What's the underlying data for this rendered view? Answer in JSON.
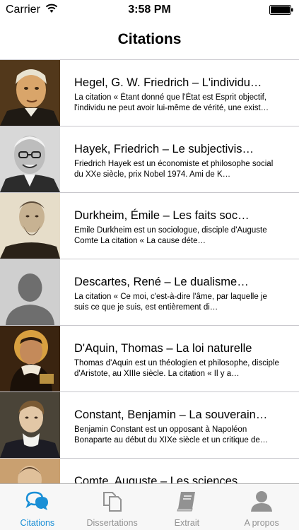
{
  "status_bar": {
    "carrier": "Carrier",
    "time": "3:58 PM"
  },
  "nav": {
    "title": "Citations"
  },
  "rows": [
    {
      "title": "Hegel, G. W. Friedrich – L'individu…",
      "subtitle": "La citation  « Étant donné que l'État est Esprit objectif, l'individu ne peut avoir lui-même de vérité, une exist…",
      "portrait": "hegel-portrait"
    },
    {
      "title": "Hayek, Friedrich – Le subjectivis…",
      "subtitle": "Friedrich Hayek est un économiste et philosophe social du XXe siècle, prix Nobel 1974. Ami de K…",
      "portrait": "hayek-portrait"
    },
    {
      "title": "Durkheim, Émile – Les faits soc…",
      "subtitle": "Emile Durkheim est un sociologue, disciple d'Auguste Comte  La citation  « La cause déte…",
      "portrait": "durkheim-portrait"
    },
    {
      "title": "Descartes, René – Le dualisme…",
      "subtitle": "La citation  « Ce moi, c'est-à-dire l'âme, par laquelle je suis ce que je suis, est entièrement di…",
      "portrait": "placeholder-avatar"
    },
    {
      "title": "D'Aquin, Thomas – La loi naturelle",
      "subtitle": "Thomas d'Aquin est un théologien et philosophe, disciple d'Aristote, au XIIIe siècle.  La citation  « Il y a…",
      "portrait": "aquinas-portrait"
    },
    {
      "title": "Constant, Benjamin – La souverain…",
      "subtitle": "Benjamin Constant est un opposant à Napoléon Bonaparte au début du XIXe siècle et un critique de…",
      "portrait": "constant-portrait"
    },
    {
      "title": "Comte, Auguste – Les sciences",
      "subtitle": "",
      "portrait": "comte-portrait"
    }
  ],
  "tabs": [
    {
      "label": "Citations",
      "icon": "speech-bubbles-icon",
      "active": true
    },
    {
      "label": "Dissertations",
      "icon": "documents-icon",
      "active": false
    },
    {
      "label": "Extrait",
      "icon": "book-icon",
      "active": false
    },
    {
      "label": "A propos",
      "icon": "person-icon",
      "active": false
    }
  ],
  "colors": {
    "accent": "#1a8fd6",
    "tab_inactive": "#929292",
    "separator": "#c8c7cc"
  }
}
